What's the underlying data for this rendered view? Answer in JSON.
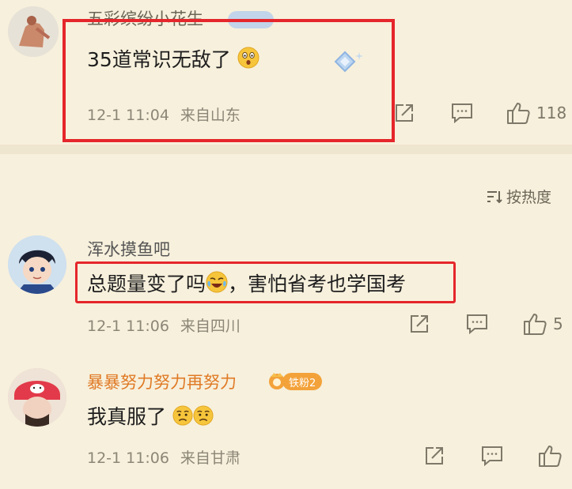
{
  "comments": [
    {
      "username": "五彩缤纷小花生",
      "text": "35道常识无敌了",
      "time": "12-1 11:04",
      "location": "来自山东",
      "likes": "118"
    },
    {
      "username": "浑水摸鱼吧",
      "text_part1": "总题量变了吗",
      "text_part2": "，害怕省考也学国考",
      "time": "12-1 11:06",
      "location": "来自四川",
      "likes": "5"
    },
    {
      "username": "暴暴努力努力再努力",
      "badge": "铁粉2",
      "text": "我真服了",
      "time": "12-1 11:06",
      "location": "来自甘肃",
      "likes": ""
    }
  ],
  "sort": {
    "label": "按热度"
  },
  "colors": {
    "highlight": "#e5262b",
    "background": "#f7f0dc",
    "fan_name": "#e07a26"
  }
}
